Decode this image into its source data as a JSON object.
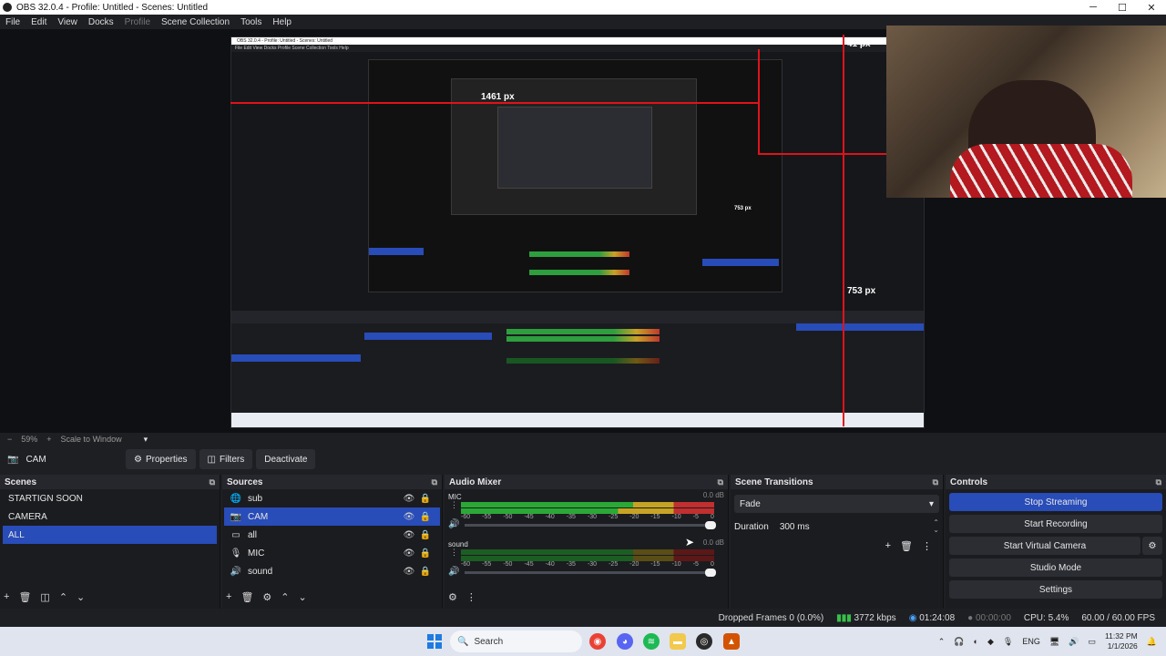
{
  "window": {
    "title": "OBS 32.0.4 - Profile: Untitled - Scenes: Untitled",
    "minimize": "─",
    "maximize": "☐",
    "close": "✕"
  },
  "menu": [
    "File",
    "Edit",
    "View",
    "Docks",
    "Profile",
    "Scene Collection",
    "Tools",
    "Help"
  ],
  "preview": {
    "nested_title": "OBS 32.0.4 - Profile: Untitled - Scenes: Untitled",
    "nested_menu": "File  Edit  View  Docks  Profile  Scene Collection  Tools  Help",
    "measure_1": "1461 px",
    "measure_2": "753 px",
    "measure_3": "753 px",
    "measure_4": "41 px"
  },
  "zoom": {
    "minus": "−",
    "value": "59%",
    "plus": "+",
    "label": "Scale to Window",
    "caret": "▾"
  },
  "source_toolbar": {
    "source_name": "CAM",
    "properties": "Properties",
    "filters": "Filters",
    "deactivate": "Deactivate"
  },
  "scenes": {
    "header": "Scenes",
    "items": [
      "STARTIGN SOON",
      "CAMERA",
      "ALL"
    ],
    "selected_index": 2
  },
  "sources": {
    "header": "Sources",
    "items": [
      {
        "label": "sub",
        "icon": "browser-icon"
      },
      {
        "label": "CAM",
        "icon": "camera-icon"
      },
      {
        "label": "all",
        "icon": "display-icon"
      },
      {
        "label": "MIC",
        "icon": "mic-icon"
      },
      {
        "label": "sound",
        "icon": "speaker-icon"
      }
    ],
    "selected_index": 1
  },
  "mixer": {
    "header": "Audio Mixer",
    "channels": [
      {
        "name": "MIC",
        "db": "0.0 dB"
      },
      {
        "name": "sound",
        "db": "0.0 dB"
      }
    ],
    "ticks": [
      "-60",
      "-55",
      "-50",
      "-45",
      "-40",
      "-35",
      "-30",
      "-25",
      "-20",
      "-15",
      "-10",
      "-5",
      "0"
    ]
  },
  "transitions": {
    "header": "Scene Transitions",
    "selected": "Fade",
    "duration_label": "Duration",
    "duration_value": "300 ms"
  },
  "controls": {
    "header": "Controls",
    "stop_streaming": "Stop Streaming",
    "start_recording": "Start Recording",
    "start_virtual_camera": "Start Virtual Camera",
    "studio_mode": "Studio Mode",
    "settings": "Settings"
  },
  "status": {
    "dropped_frames": "Dropped Frames 0 (0.0%)",
    "bitrate": "3772 kbps",
    "stream_time": "01:24:08",
    "record_time": "00:00:00",
    "cpu": "CPU: 5.4%",
    "fps": "60.00 / 60.00 FPS"
  },
  "taskbar": {
    "search": "Search",
    "lang": "ENG",
    "time": "11:32 PM",
    "date": "1/1/2026"
  },
  "colors": {
    "accent": "#284cb8",
    "measure_red": "#e0131a"
  }
}
